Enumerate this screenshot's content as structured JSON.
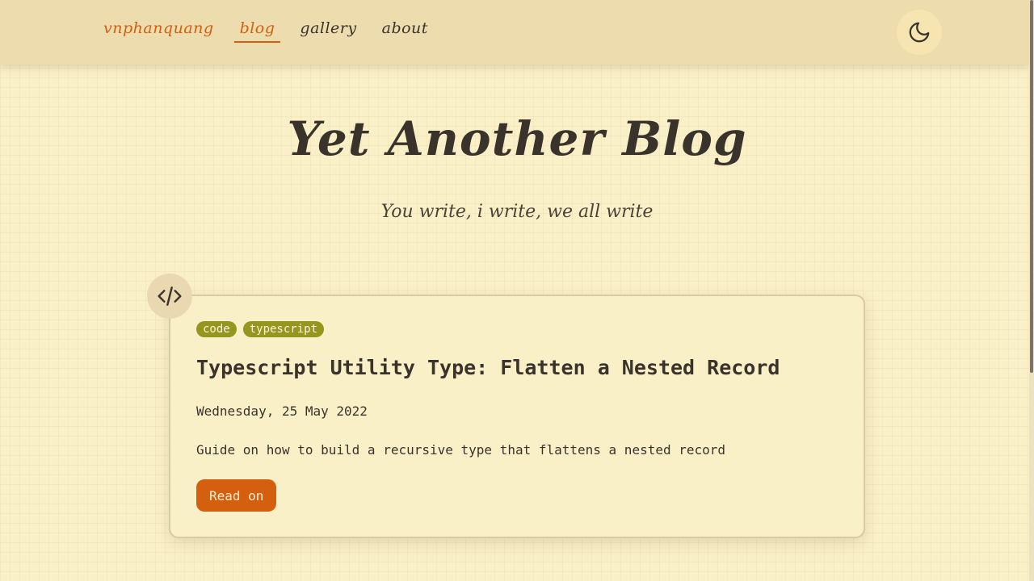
{
  "nav": {
    "brand": "vnphanquang",
    "links": [
      {
        "label": "blog",
        "active": true
      },
      {
        "label": "gallery",
        "active": false
      },
      {
        "label": "about",
        "active": false
      }
    ],
    "theme_toggle_icon": "moon-icon"
  },
  "hero": {
    "title": "Yet Another Blog",
    "subtitle": "You write, i write, we all write"
  },
  "posts": [
    {
      "icon": "code-icon",
      "tags": [
        "code",
        "typescript"
      ],
      "title": "Typescript Utility Type: Flatten a Nested Record",
      "date": "Wednesday, 25 May 2022",
      "description": "Guide on how to build a recursive type that flattens a nested record",
      "cta": "Read on"
    }
  ],
  "colors": {
    "accent": "#d45f0e",
    "tag": "#949620",
    "background": "#faf0c8",
    "header": "#ecdcae"
  }
}
